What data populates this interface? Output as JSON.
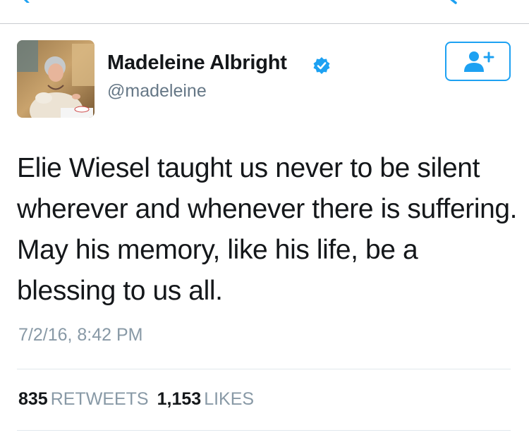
{
  "nav": {
    "back_icon": "chevron-left-icon",
    "reply_icon": "reply-icon",
    "profile_icon": "profile-icon"
  },
  "tweet": {
    "author_name": "Madeleine Albright",
    "handle": "@madeleine",
    "verified": true,
    "follow_icon": "add-user-icon",
    "text": "Elie Wiesel taught us never to be silent wherever and whenever there is suffering. May his memory, like his life, be a blessing to us all.",
    "timestamp": "7/2/16, 8:42 PM",
    "retweets_count": "835",
    "retweets_label": "RETWEETS",
    "likes_count": "1,153",
    "likes_label": "LIKES"
  },
  "colors": {
    "accent": "#1da1f2",
    "text": "#14171a",
    "secondary": "#657786",
    "muted": "#8899a6",
    "divider": "#e1e8ed"
  }
}
